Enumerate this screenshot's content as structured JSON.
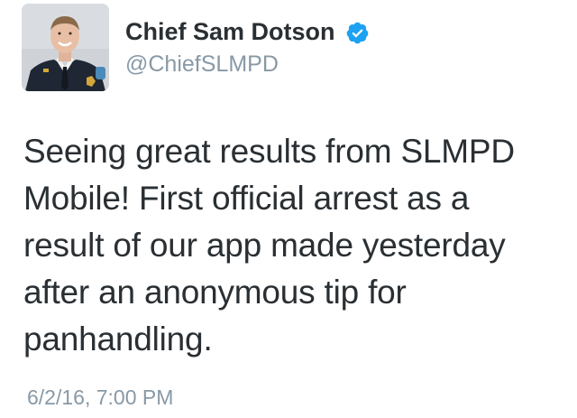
{
  "author": {
    "display_name": "Chief Sam Dotson",
    "handle": "@ChiefSLMPD",
    "verified": true
  },
  "tweet": {
    "lines": [
      "Seeing great results from SLMPD",
      "Mobile! First official arrest as a",
      "result of our app made yesterday",
      "after an anonymous tip for",
      "panhandling."
    ],
    "timestamp": "6/2/16, 7:00 PM"
  },
  "colors": {
    "text": "#292f33",
    "muted": "#8899a6",
    "verified_badge": "#1da1f2"
  },
  "icons": {
    "verified": "verified-badge-icon",
    "avatar": "profile-photo"
  }
}
